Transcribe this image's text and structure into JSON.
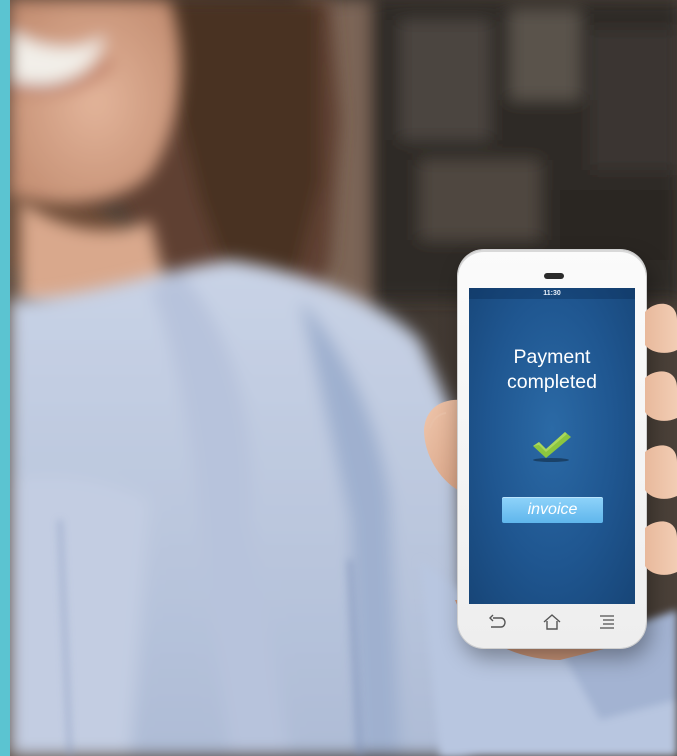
{
  "colors": {
    "accent_strip": "#5bc4d1",
    "screen_bg": "#1f5690",
    "checkmark": "#8cc63f",
    "invoice_button": "#6cc0ef"
  },
  "phone": {
    "status_time": "11:30",
    "title_line1": "Payment",
    "title_line2": "completed",
    "invoice_label": "invoice",
    "nav": {
      "back_icon": "back-arrow-icon",
      "home_icon": "home-icon",
      "menu_icon": "menu-icon"
    }
  }
}
